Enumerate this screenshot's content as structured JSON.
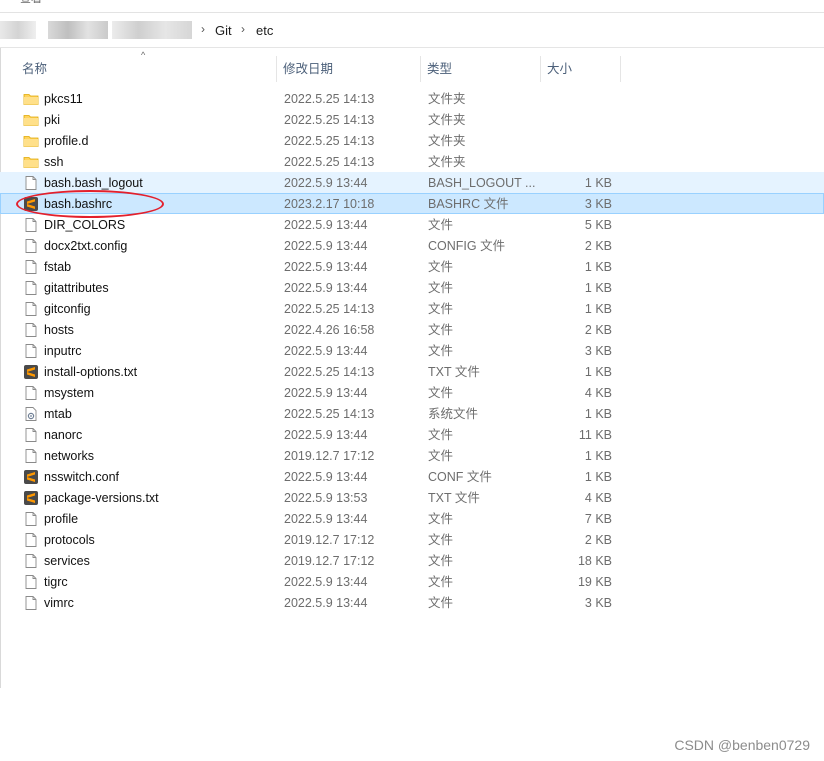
{
  "window": {
    "menu_fragment": "查看"
  },
  "breadcrumb": {
    "items": [
      "Git",
      "etc"
    ]
  },
  "columns": {
    "name": "名称",
    "modified": "修改日期",
    "type": "类型",
    "size": "大小"
  },
  "files": [
    {
      "name": "pkcs11",
      "date": "2022.5.25 14:13",
      "type": "文件夹",
      "size": "",
      "icon": "folder-icon"
    },
    {
      "name": "pki",
      "date": "2022.5.25 14:13",
      "type": "文件夹",
      "size": "",
      "icon": "folder-icon"
    },
    {
      "name": "profile.d",
      "date": "2022.5.25 14:13",
      "type": "文件夹",
      "size": "",
      "icon": "folder-icon"
    },
    {
      "name": "ssh",
      "date": "2022.5.25 14:13",
      "type": "文件夹",
      "size": "",
      "icon": "folder-icon"
    },
    {
      "name": "bash.bash_logout",
      "date": "2022.5.9 13:44",
      "type": "BASH_LOGOUT ...",
      "size": "1 KB",
      "icon": "file-icon",
      "state": "hover"
    },
    {
      "name": "bash.bashrc",
      "date": "2023.2.17 10:18",
      "type": "BASHRC 文件",
      "size": "3 KB",
      "icon": "sublime-text-icon",
      "state": "selected"
    },
    {
      "name": "DIR_COLORS",
      "date": "2022.5.9 13:44",
      "type": "文件",
      "size": "5 KB",
      "icon": "file-icon"
    },
    {
      "name": "docx2txt.config",
      "date": "2022.5.9 13:44",
      "type": "CONFIG 文件",
      "size": "2 KB",
      "icon": "file-icon"
    },
    {
      "name": "fstab",
      "date": "2022.5.9 13:44",
      "type": "文件",
      "size": "1 KB",
      "icon": "file-icon"
    },
    {
      "name": "gitattributes",
      "date": "2022.5.9 13:44",
      "type": "文件",
      "size": "1 KB",
      "icon": "file-icon"
    },
    {
      "name": "gitconfig",
      "date": "2022.5.25 14:13",
      "type": "文件",
      "size": "1 KB",
      "icon": "file-icon"
    },
    {
      "name": "hosts",
      "date": "2022.4.26 16:58",
      "type": "文件",
      "size": "2 KB",
      "icon": "file-icon"
    },
    {
      "name": "inputrc",
      "date": "2022.5.9 13:44",
      "type": "文件",
      "size": "3 KB",
      "icon": "file-icon"
    },
    {
      "name": "install-options.txt",
      "date": "2022.5.25 14:13",
      "type": "TXT 文件",
      "size": "1 KB",
      "icon": "sublime-text-icon"
    },
    {
      "name": "msystem",
      "date": "2022.5.9 13:44",
      "type": "文件",
      "size": "4 KB",
      "icon": "file-icon"
    },
    {
      "name": "mtab",
      "date": "2022.5.25 14:13",
      "type": "系统文件",
      "size": "1 KB",
      "icon": "system-file-icon"
    },
    {
      "name": "nanorc",
      "date": "2022.5.9 13:44",
      "type": "文件",
      "size": "11 KB",
      "icon": "file-icon"
    },
    {
      "name": "networks",
      "date": "2019.12.7 17:12",
      "type": "文件",
      "size": "1 KB",
      "icon": "file-icon"
    },
    {
      "name": "nsswitch.conf",
      "date": "2022.5.9 13:44",
      "type": "CONF 文件",
      "size": "1 KB",
      "icon": "sublime-text-icon"
    },
    {
      "name": "package-versions.txt",
      "date": "2022.5.9 13:53",
      "type": "TXT 文件",
      "size": "4 KB",
      "icon": "sublime-text-icon"
    },
    {
      "name": "profile",
      "date": "2022.5.9 13:44",
      "type": "文件",
      "size": "7 KB",
      "icon": "file-icon"
    },
    {
      "name": "protocols",
      "date": "2019.12.7 17:12",
      "type": "文件",
      "size": "2 KB",
      "icon": "file-icon"
    },
    {
      "name": "services",
      "date": "2019.12.7 17:12",
      "type": "文件",
      "size": "18 KB",
      "icon": "file-icon"
    },
    {
      "name": "tigrc",
      "date": "2022.5.9 13:44",
      "type": "文件",
      "size": "19 KB",
      "icon": "file-icon"
    },
    {
      "name": "vimrc",
      "date": "2022.5.9 13:44",
      "type": "文件",
      "size": "3 KB",
      "icon": "file-icon"
    }
  ],
  "colors": {
    "selected_bg": "#cce8ff",
    "selected_border": "#99d1ff",
    "hover_bg": "#e5f3ff",
    "folder": "#ffd35c",
    "sublime": "#ff9800",
    "annotation": "#e3202c"
  },
  "watermark": "CSDN @benben0729"
}
